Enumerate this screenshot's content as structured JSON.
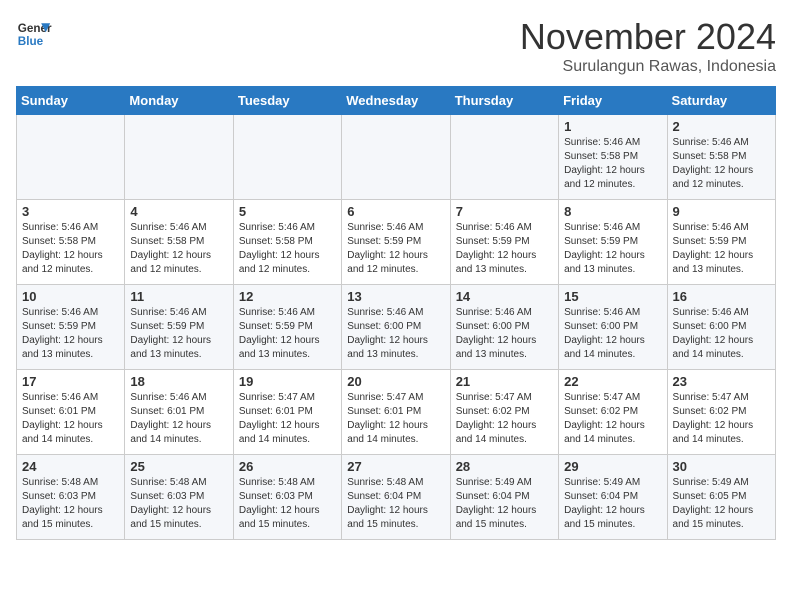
{
  "logo": {
    "line1": "General",
    "line2": "Blue"
  },
  "title": "November 2024",
  "location": "Surulangun Rawas, Indonesia",
  "days_of_week": [
    "Sunday",
    "Monday",
    "Tuesday",
    "Wednesday",
    "Thursday",
    "Friday",
    "Saturday"
  ],
  "weeks": [
    [
      {
        "day": "",
        "info": ""
      },
      {
        "day": "",
        "info": ""
      },
      {
        "day": "",
        "info": ""
      },
      {
        "day": "",
        "info": ""
      },
      {
        "day": "",
        "info": ""
      },
      {
        "day": "1",
        "info": "Sunrise: 5:46 AM\nSunset: 5:58 PM\nDaylight: 12 hours\nand 12 minutes."
      },
      {
        "day": "2",
        "info": "Sunrise: 5:46 AM\nSunset: 5:58 PM\nDaylight: 12 hours\nand 12 minutes."
      }
    ],
    [
      {
        "day": "3",
        "info": "Sunrise: 5:46 AM\nSunset: 5:58 PM\nDaylight: 12 hours\nand 12 minutes."
      },
      {
        "day": "4",
        "info": "Sunrise: 5:46 AM\nSunset: 5:58 PM\nDaylight: 12 hours\nand 12 minutes."
      },
      {
        "day": "5",
        "info": "Sunrise: 5:46 AM\nSunset: 5:58 PM\nDaylight: 12 hours\nand 12 minutes."
      },
      {
        "day": "6",
        "info": "Sunrise: 5:46 AM\nSunset: 5:59 PM\nDaylight: 12 hours\nand 12 minutes."
      },
      {
        "day": "7",
        "info": "Sunrise: 5:46 AM\nSunset: 5:59 PM\nDaylight: 12 hours\nand 13 minutes."
      },
      {
        "day": "8",
        "info": "Sunrise: 5:46 AM\nSunset: 5:59 PM\nDaylight: 12 hours\nand 13 minutes."
      },
      {
        "day": "9",
        "info": "Sunrise: 5:46 AM\nSunset: 5:59 PM\nDaylight: 12 hours\nand 13 minutes."
      }
    ],
    [
      {
        "day": "10",
        "info": "Sunrise: 5:46 AM\nSunset: 5:59 PM\nDaylight: 12 hours\nand 13 minutes."
      },
      {
        "day": "11",
        "info": "Sunrise: 5:46 AM\nSunset: 5:59 PM\nDaylight: 12 hours\nand 13 minutes."
      },
      {
        "day": "12",
        "info": "Sunrise: 5:46 AM\nSunset: 5:59 PM\nDaylight: 12 hours\nand 13 minutes."
      },
      {
        "day": "13",
        "info": "Sunrise: 5:46 AM\nSunset: 6:00 PM\nDaylight: 12 hours\nand 13 minutes."
      },
      {
        "day": "14",
        "info": "Sunrise: 5:46 AM\nSunset: 6:00 PM\nDaylight: 12 hours\nand 13 minutes."
      },
      {
        "day": "15",
        "info": "Sunrise: 5:46 AM\nSunset: 6:00 PM\nDaylight: 12 hours\nand 14 minutes."
      },
      {
        "day": "16",
        "info": "Sunrise: 5:46 AM\nSunset: 6:00 PM\nDaylight: 12 hours\nand 14 minutes."
      }
    ],
    [
      {
        "day": "17",
        "info": "Sunrise: 5:46 AM\nSunset: 6:01 PM\nDaylight: 12 hours\nand 14 minutes."
      },
      {
        "day": "18",
        "info": "Sunrise: 5:46 AM\nSunset: 6:01 PM\nDaylight: 12 hours\nand 14 minutes."
      },
      {
        "day": "19",
        "info": "Sunrise: 5:47 AM\nSunset: 6:01 PM\nDaylight: 12 hours\nand 14 minutes."
      },
      {
        "day": "20",
        "info": "Sunrise: 5:47 AM\nSunset: 6:01 PM\nDaylight: 12 hours\nand 14 minutes."
      },
      {
        "day": "21",
        "info": "Sunrise: 5:47 AM\nSunset: 6:02 PM\nDaylight: 12 hours\nand 14 minutes."
      },
      {
        "day": "22",
        "info": "Sunrise: 5:47 AM\nSunset: 6:02 PM\nDaylight: 12 hours\nand 14 minutes."
      },
      {
        "day": "23",
        "info": "Sunrise: 5:47 AM\nSunset: 6:02 PM\nDaylight: 12 hours\nand 14 minutes."
      }
    ],
    [
      {
        "day": "24",
        "info": "Sunrise: 5:48 AM\nSunset: 6:03 PM\nDaylight: 12 hours\nand 15 minutes."
      },
      {
        "day": "25",
        "info": "Sunrise: 5:48 AM\nSunset: 6:03 PM\nDaylight: 12 hours\nand 15 minutes."
      },
      {
        "day": "26",
        "info": "Sunrise: 5:48 AM\nSunset: 6:03 PM\nDaylight: 12 hours\nand 15 minutes."
      },
      {
        "day": "27",
        "info": "Sunrise: 5:48 AM\nSunset: 6:04 PM\nDaylight: 12 hours\nand 15 minutes."
      },
      {
        "day": "28",
        "info": "Sunrise: 5:49 AM\nSunset: 6:04 PM\nDaylight: 12 hours\nand 15 minutes."
      },
      {
        "day": "29",
        "info": "Sunrise: 5:49 AM\nSunset: 6:04 PM\nDaylight: 12 hours\nand 15 minutes."
      },
      {
        "day": "30",
        "info": "Sunrise: 5:49 AM\nSunset: 6:05 PM\nDaylight: 12 hours\nand 15 minutes."
      }
    ]
  ]
}
